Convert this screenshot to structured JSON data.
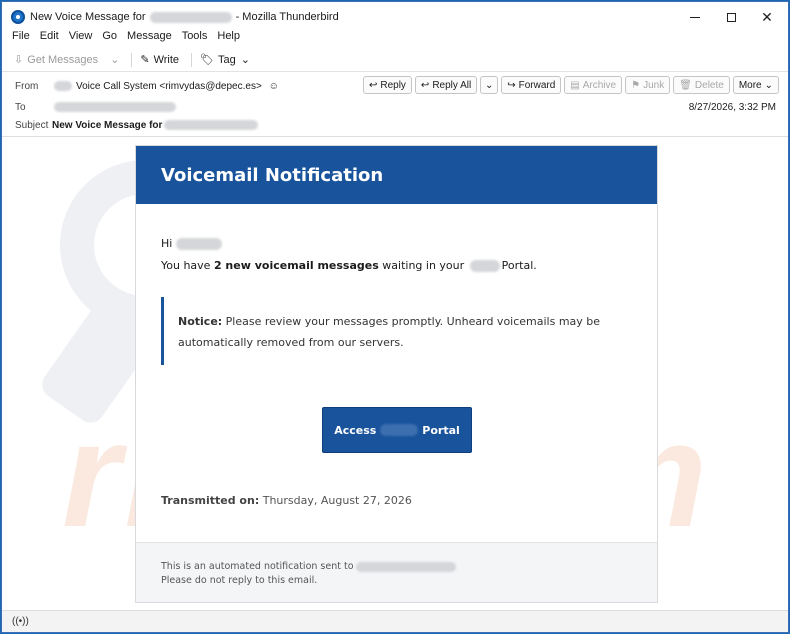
{
  "window": {
    "title_prefix": "New Voice Message for",
    "title_suffix": "- Mozilla Thunderbird"
  },
  "menu": [
    "File",
    "Edit",
    "View",
    "Go",
    "Message",
    "Tools",
    "Help"
  ],
  "toolbar": {
    "get_messages": "Get Messages",
    "write": "Write",
    "tag": "Tag"
  },
  "header": {
    "from_label": "From",
    "to_label": "To",
    "subject_label": "Subject",
    "from_value": "Voice Call System <rimvydas@depec.es>",
    "subject_value": "New Voice Message for",
    "date": "8/27/2026, 3:32 PM",
    "actions": {
      "reply": "Reply",
      "reply_all": "Reply All",
      "forward": "Forward",
      "archive": "Archive",
      "junk": "Junk",
      "delete": "Delete",
      "more": "More"
    }
  },
  "email": {
    "title": "Voicemail Notification",
    "greeting": "Hi",
    "msg_pre": "You have ",
    "msg_bold": "2 new voicemail messages",
    "msg_mid": " waiting in your ",
    "msg_post": "Portal.",
    "notice_label": "Notice:",
    "notice_text": " Please review your messages promptly. Unheard voicemails may be automatically removed from our servers.",
    "cta_left": "Access",
    "cta_right": "Portal",
    "transmitted_label": "Transmitted on:",
    "transmitted_value": " Thursday, August 27, 2026",
    "footer_line1": "This is an automated notification sent to",
    "footer_line2": "Please do not reply to this email."
  },
  "watermark": {
    "text": "risk.com"
  },
  "colors": {
    "brand": "#18539c",
    "window_border": "#1c66b6"
  }
}
